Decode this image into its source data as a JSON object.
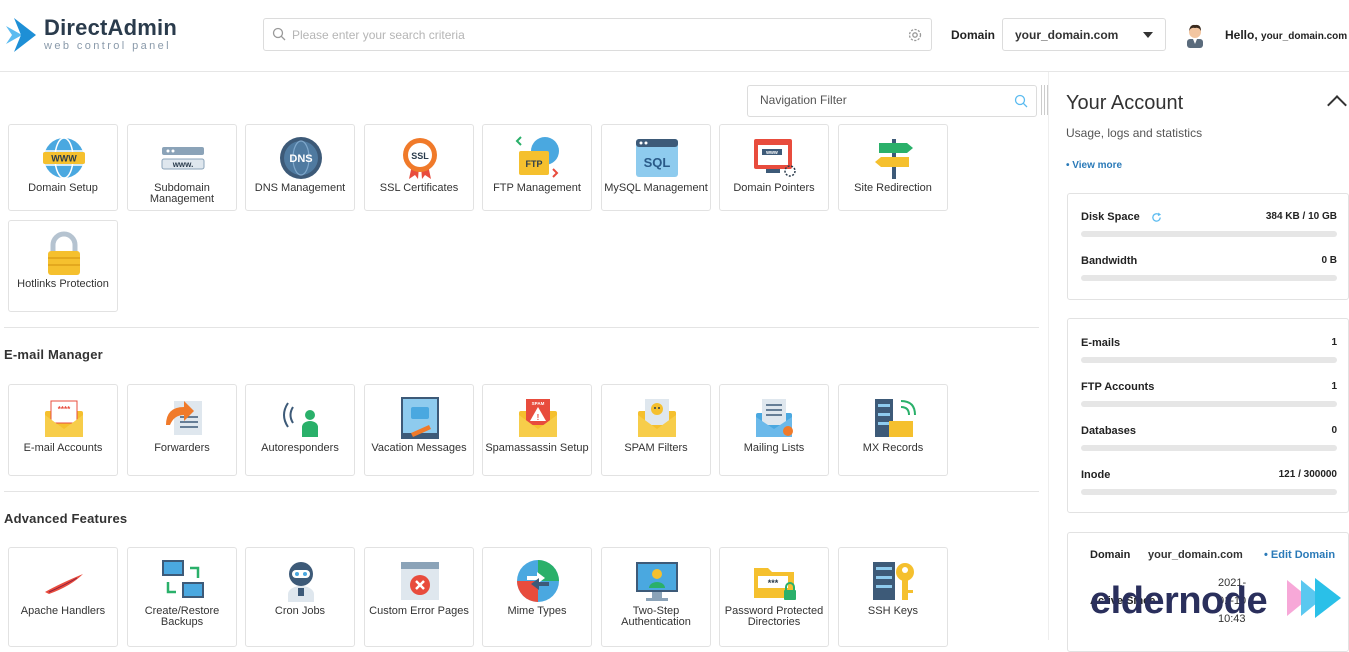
{
  "header": {
    "logo_name": "DirectAdmin",
    "logo_sub": "web control panel",
    "search_placeholder": "Please enter your search criteria",
    "domain_label": "Domain",
    "domain_value": "your_domain.com",
    "hello": "Hello,",
    "hello_domain": "your_domain.com"
  },
  "nav_filter": {
    "placeholder": "Navigation Filter"
  },
  "sections": {
    "top": {
      "items": [
        {
          "label": "Domain Setup"
        },
        {
          "label": "Subdomain Management"
        },
        {
          "label": "DNS Management"
        },
        {
          "label": "SSL Certificates"
        },
        {
          "label": "FTP Management"
        },
        {
          "label": "MySQL Management"
        },
        {
          "label": "Domain Pointers"
        },
        {
          "label": "Site Redirection"
        },
        {
          "label": "Hotlinks Protection"
        }
      ]
    },
    "email": {
      "title": "E-mail Manager",
      "items": [
        {
          "label": "E-mail Accounts"
        },
        {
          "label": "Forwarders"
        },
        {
          "label": "Autoresponders"
        },
        {
          "label": "Vacation Messages"
        },
        {
          "label": "Spamassassin Setup"
        },
        {
          "label": "SPAM Filters"
        },
        {
          "label": "Mailing Lists"
        },
        {
          "label": "MX Records"
        }
      ]
    },
    "advanced": {
      "title": "Advanced Features",
      "items": [
        {
          "label": "Apache Handlers"
        },
        {
          "label": "Create/Restore Backups"
        },
        {
          "label": "Cron Jobs"
        },
        {
          "label": "Custom Error Pages"
        },
        {
          "label": "Mime Types"
        },
        {
          "label": "Two-Step Authentication"
        },
        {
          "label": "Password Protected Directories"
        },
        {
          "label": "SSH Keys"
        }
      ]
    }
  },
  "account": {
    "title": "Your Account",
    "subtitle": "Usage, logs and statistics",
    "view_more": "• View more",
    "usage": [
      {
        "label": "Disk Space",
        "value": "384 KB / 10 GB",
        "fraction": 0.0
      },
      {
        "label": "Bandwidth",
        "value": "0 B",
        "fraction": 0.0
      }
    ],
    "counts": [
      {
        "label": "E-mails",
        "value": "1",
        "fraction": 0.0
      },
      {
        "label": "FTP Accounts",
        "value": "1",
        "fraction": 0.0
      },
      {
        "label": "Databases",
        "value": "0",
        "fraction": 0.0
      },
      {
        "label": "Inode",
        "value": "121 / 300000",
        "fraction": 0.0
      }
    ],
    "domain_label": "Domain",
    "domain_value": "your_domain.com",
    "edit_domain": "• Edit Domain",
    "active_since_label": "Active Since",
    "active_since_year": "2021-",
    "active_since_date": "01-10",
    "active_since_time": "10:43"
  },
  "watermark": "eldernode",
  "colors": {
    "accent": "#2a7ab8",
    "logo_blue": "#1e8fd6",
    "bar_bg": "#e6e6e6"
  }
}
